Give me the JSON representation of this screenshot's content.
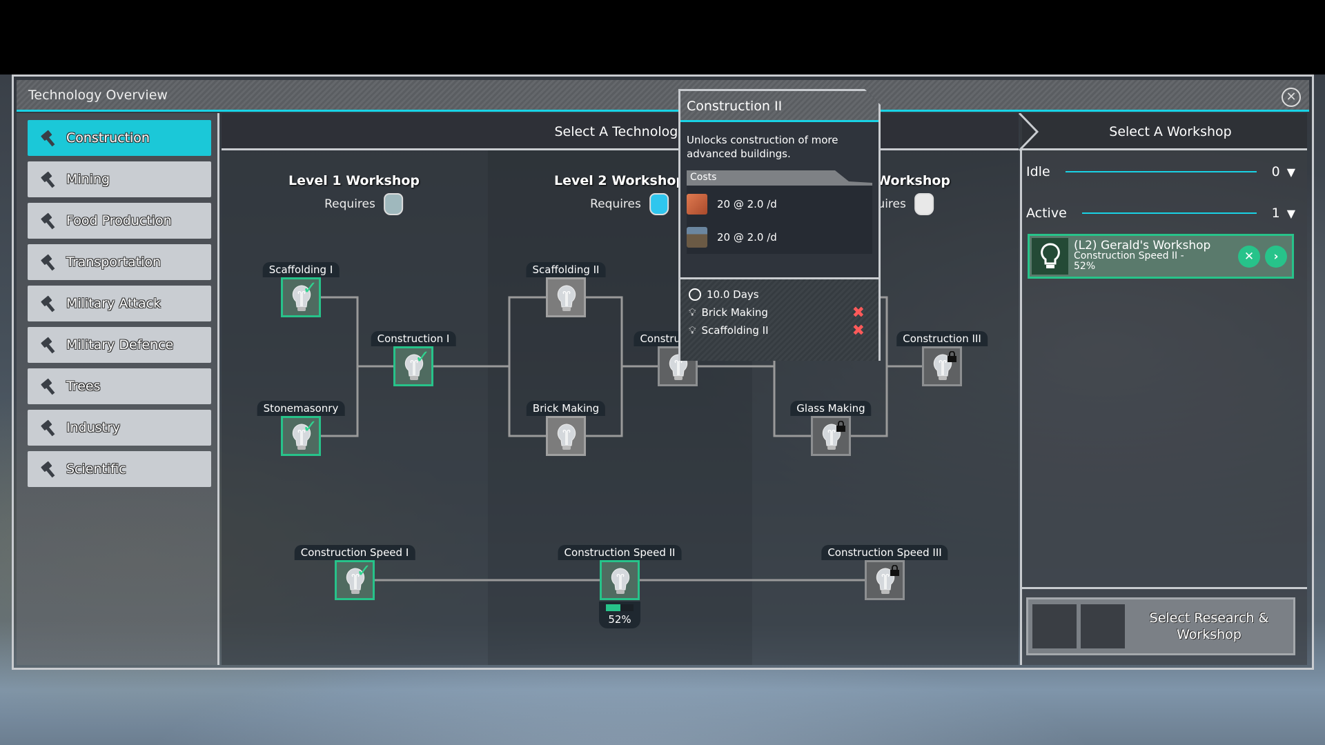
{
  "window": {
    "title": "Technology Overview",
    "close_icon": "close-circle-icon"
  },
  "sidebar": {
    "items": [
      {
        "label": "Construction",
        "active": true
      },
      {
        "label": "Mining"
      },
      {
        "label": "Food Production"
      },
      {
        "label": "Transportation"
      },
      {
        "label": "Military Attack"
      },
      {
        "label": "Military Defence"
      },
      {
        "label": "Trees"
      },
      {
        "label": "Industry"
      },
      {
        "label": "Scientific"
      }
    ]
  },
  "tree": {
    "header": "Select A Technology",
    "levels": [
      {
        "title": "Level 1 Workshop",
        "requires": "Requires",
        "jar_color": "#9fb8bd"
      },
      {
        "title": "Level 2 Workshop",
        "requires": "Requires",
        "jar_color": "#2fc6ee"
      },
      {
        "title": "Level 3 Workshop",
        "requires": "Requires",
        "jar_color": "#e8e8e8"
      }
    ],
    "nodes": [
      {
        "label": "Scaffolding I",
        "state": "done"
      },
      {
        "label": "Stonemasonry",
        "state": "done"
      },
      {
        "label": "Construction I",
        "state": "done"
      },
      {
        "label": "Scaffolding II",
        "state": "available"
      },
      {
        "label": "Brick Making",
        "state": "available"
      },
      {
        "label": "Construction II",
        "state": "selected"
      },
      {
        "label": "Glass Making",
        "state": "locked"
      },
      {
        "label": "Construction III",
        "state": "locked"
      },
      {
        "label": "Construction Speed I",
        "state": "done"
      },
      {
        "label": "Construction Speed II",
        "state": "progress",
        "progress": "52%",
        "progress_value": 0.52
      },
      {
        "label": "Construction Speed III",
        "state": "locked"
      }
    ]
  },
  "tooltip": {
    "title": "Construction II",
    "description": "Unlocks construction of more advanced buildings.",
    "costs_label": "Costs",
    "costs": [
      {
        "resource_icon": "bricks-icon",
        "amount": "20 @ 2.0 /d",
        "color": "#c8643e"
      },
      {
        "resource_icon": "stone-crate-icon",
        "amount": "20 @ 2.0 /d",
        "color": "#6b6255"
      }
    ],
    "duration": "10.0 Days",
    "prerequisites": [
      {
        "label": "Brick Making",
        "met": false
      },
      {
        "label": "Scaffolding II",
        "met": false
      }
    ]
  },
  "workshops": {
    "header": "Select A Workshop",
    "idle": {
      "label": "Idle",
      "count": "0"
    },
    "active": {
      "label": "Active",
      "count": "1"
    },
    "card": {
      "name": "(L2) Gerald's Workshop",
      "task": "Construction Speed II -",
      "progress": "52%",
      "cancel": "✕",
      "go": "›"
    },
    "select_button": "Select Research & Workshop"
  },
  "colors": {
    "accent": "#19d3e6",
    "complete": "#27c38a",
    "error": "#ff5a5a"
  }
}
